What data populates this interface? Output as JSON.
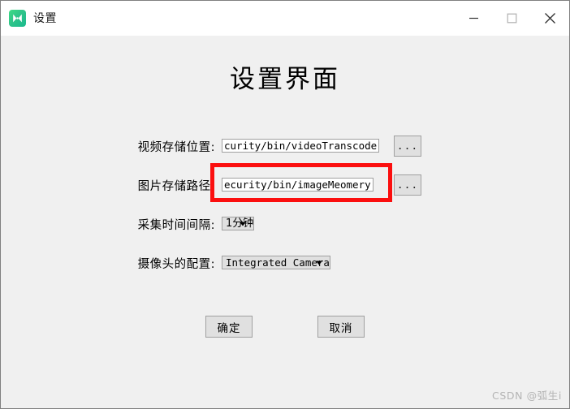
{
  "window": {
    "title": "设置",
    "icon": "app-logo-icon",
    "controls": {
      "minimize": "minimize-icon",
      "maximize": "maximize-icon",
      "close": "close-icon"
    }
  },
  "page": {
    "heading": "设置界面"
  },
  "form": {
    "rows": [
      {
        "label": "视频存储位置:",
        "type": "text",
        "value": "curity/bin/videoTranscode",
        "placeholder": "",
        "browse_label": "...",
        "highlighted": true
      },
      {
        "label": "图片存储路径:",
        "type": "text",
        "value": "ecurity/bin/imageMeomery",
        "placeholder": "",
        "browse_label": "...",
        "highlighted": false
      },
      {
        "label": "采集时间间隔:",
        "type": "combo",
        "value": "1分钟",
        "options": [
          "1分钟"
        ],
        "highlighted": false
      },
      {
        "label": "摄像头的配置:",
        "type": "combo",
        "value": "Integrated Camera",
        "options": [
          "Integrated Camera"
        ],
        "highlighted": false
      }
    ]
  },
  "actions": {
    "confirm_label": "确定",
    "cancel_label": "取消"
  },
  "watermark": {
    "text": "CSDN @弧生i"
  },
  "colors": {
    "highlight": "#fb0f0f",
    "window_bg": "#f0f0f0",
    "titlebar_bg": "#ffffff",
    "control_bg": "#e0e0e0",
    "border": "#a0a0a0",
    "icon_green": "#2fc489"
  }
}
